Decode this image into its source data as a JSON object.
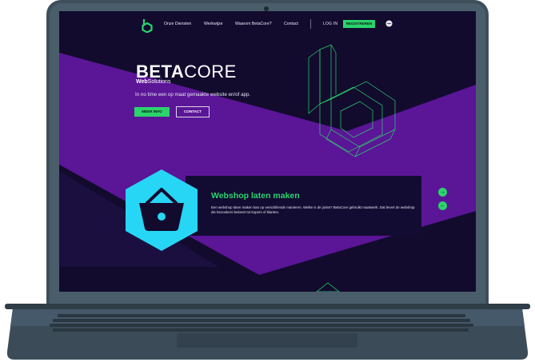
{
  "nav": {
    "items": [
      "Onze Diensten",
      "Werkwijze",
      "Waarom BetaCore?",
      "Contact"
    ],
    "login": "LOG IN",
    "register": "REGISTREREN"
  },
  "hero": {
    "brand_bold": "BETA",
    "brand_light": "CORE",
    "sub_bold": "Web",
    "sub_light": "Solutions",
    "tagline": "In no time een op maat gemaakte website en/of app.",
    "more_button": "MEER INFO",
    "contact_button": "CONTACT"
  },
  "service": {
    "title": "Webshop laten maken",
    "text": "Een webshop laten maken kan op verschillende manieren. Welke is de juiste? BetaCore gebruikt maatwerk. Dat levert de webshop die bezoekers bekeert tot kopers of klanten.",
    "icon": "shopping-basket-icon"
  },
  "colors": {
    "accent": "#2bd36c",
    "purple": "#5b1597",
    "dark": "#120b2e",
    "cyan": "#27d6f5"
  }
}
